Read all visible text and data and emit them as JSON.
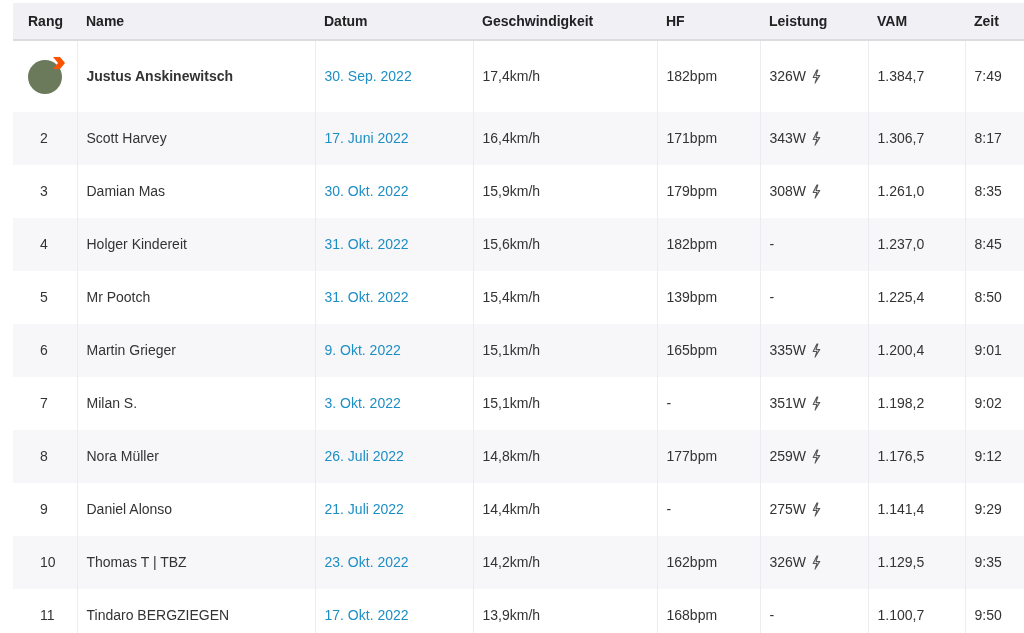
{
  "table": {
    "columns": [
      "Rang",
      "Name",
      "Datum",
      "Geschwindigkeit",
      "HF",
      "Leistung",
      "VAM",
      "Zeit"
    ],
    "rows": [
      {
        "kind": "leader",
        "rank": "",
        "name": "Justus Anskinewitsch",
        "date": "30. Sep. 2022",
        "speed": "17,4km/h",
        "hr": "182bpm",
        "power": "326W",
        "power_meter": true,
        "vam": "1.384,7",
        "time": "7:49"
      },
      {
        "kind": "ranked",
        "rank": "2",
        "name": "Scott Harvey",
        "date": "17. Juni 2022",
        "speed": "16,4km/h",
        "hr": "171bpm",
        "power": "343W",
        "power_meter": true,
        "vam": "1.306,7",
        "time": "8:17"
      },
      {
        "kind": "ranked",
        "rank": "3",
        "name": "Damian Mas",
        "date": "30. Okt. 2022",
        "speed": "15,9km/h",
        "hr": "179bpm",
        "power": "308W",
        "power_meter": true,
        "vam": "1.261,0",
        "time": "8:35"
      },
      {
        "kind": "ranked",
        "rank": "4",
        "name": "Holger Kindereit",
        "date": "31. Okt. 2022",
        "speed": "15,6km/h",
        "hr": "182bpm",
        "power": "-",
        "power_meter": false,
        "vam": "1.237,0",
        "time": "8:45"
      },
      {
        "kind": "ranked",
        "rank": "5",
        "name": "Mr Pootch",
        "date": "31. Okt. 2022",
        "speed": "15,4km/h",
        "hr": "139bpm",
        "power": "-",
        "power_meter": false,
        "vam": "1.225,4",
        "time": "8:50"
      },
      {
        "kind": "ranked",
        "rank": "6",
        "name": "Martin Grieger",
        "date": "9. Okt. 2022",
        "speed": "15,1km/h",
        "hr": "165bpm",
        "power": "335W",
        "power_meter": true,
        "vam": "1.200,4",
        "time": "9:01"
      },
      {
        "kind": "ranked",
        "rank": "7",
        "name": "Milan S.",
        "date": "3. Okt. 2022",
        "speed": "15,1km/h",
        "hr": "-",
        "power": "351W",
        "power_meter": true,
        "vam": "1.198,2",
        "time": "9:02"
      },
      {
        "kind": "ranked",
        "rank": "8",
        "name": "Nora Müller",
        "date": "26. Juli 2022",
        "speed": "14,8km/h",
        "hr": "177bpm",
        "power": "259W",
        "power_meter": true,
        "vam": "1.176,5",
        "time": "9:12"
      },
      {
        "kind": "ranked",
        "rank": "9",
        "name": "Daniel Alonso",
        "date": "21. Juli 2022",
        "speed": "14,4km/h",
        "hr": "-",
        "power": "275W",
        "power_meter": true,
        "vam": "1.141,4",
        "time": "9:29"
      },
      {
        "kind": "ranked",
        "rank": "10",
        "name": "Thomas T | TBZ",
        "date": "23. Okt. 2022",
        "speed": "14,2km/h",
        "hr": "162bpm",
        "power": "326W",
        "power_meter": true,
        "vam": "1.129,5",
        "time": "9:35"
      },
      {
        "kind": "ranked",
        "rank": "11",
        "name": "Tindaro BERGZIEGEN",
        "date": "17. Okt. 2022",
        "speed": "13,9km/h",
        "hr": "168bpm",
        "power": "-",
        "power_meter": false,
        "vam": "1.100,7",
        "time": "9:50"
      }
    ]
  }
}
